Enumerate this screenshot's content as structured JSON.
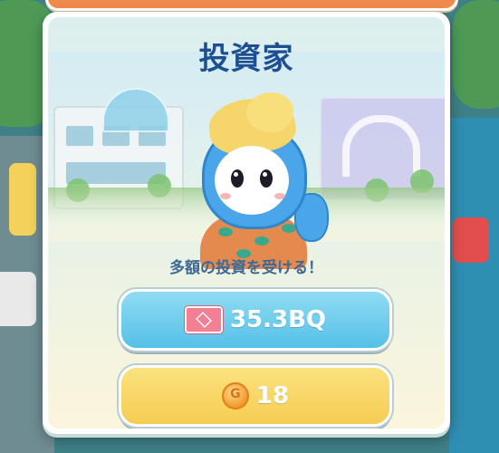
{
  "dialog": {
    "title": "投資家",
    "subtitle": "多額の投資を受ける！",
    "buttons": [
      {
        "label": "35.3BQ",
        "icon": "ticket-icon",
        "color": "#55c0e7"
      },
      {
        "label": "18",
        "icon": "coin-icon",
        "color": "#f6cc52"
      }
    ]
  },
  "colors": {
    "title": "#1f4f93",
    "subtitle": "#3d6a94",
    "top_strip": "#f08a4b"
  }
}
